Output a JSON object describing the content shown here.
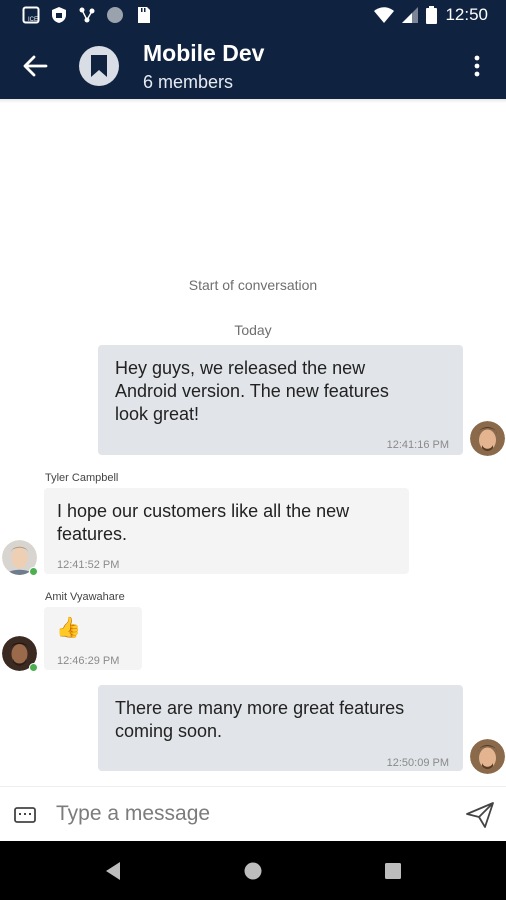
{
  "status_bar": {
    "time": "12:50"
  },
  "header": {
    "title": "Mobile Dev",
    "subtitle": "6 members"
  },
  "conversation": {
    "start_label": "Start of conversation",
    "date_label": "Today",
    "messages": [
      {
        "direction": "outgoing",
        "sender": "",
        "lines": [
          "Hey guys, we released the new",
          "Android version. The new features",
          "look great!"
        ],
        "time": "12:41:16 PM"
      },
      {
        "direction": "incoming",
        "sender": "Tyler Campbell",
        "lines": [
          "I hope our customers like all the new",
          "features."
        ],
        "time": "12:41:52 PM"
      },
      {
        "direction": "incoming",
        "sender": "Amit Vyawahare",
        "lines": [
          "👍"
        ],
        "time": "12:46:29 PM"
      },
      {
        "direction": "outgoing",
        "sender": "",
        "lines": [
          "There are many more great features",
          "coming soon."
        ],
        "time": "12:50:09 PM"
      }
    ]
  },
  "composer": {
    "placeholder": "Type a message"
  },
  "colors": {
    "header_bg": "#0f2240",
    "outgoing_bubble": "#e1e4e8",
    "incoming_bubble": "#f4f4f4",
    "presence_online": "#4caf50"
  },
  "icons": [
    "back-arrow-icon",
    "bookmark-icon",
    "more-vert-icon",
    "keyboard-icon",
    "send-icon",
    "nav-back-icon",
    "nav-home-icon",
    "nav-recents-icon"
  ]
}
